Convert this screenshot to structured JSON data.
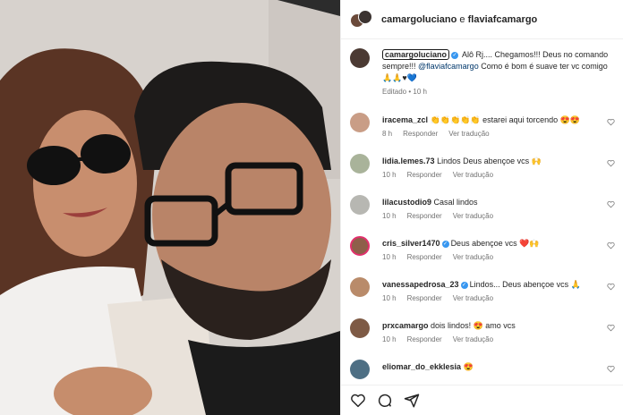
{
  "header": {
    "user1": "camargoluciano",
    "connector": "e",
    "user2": "flaviafcamargo"
  },
  "caption": {
    "username": "camargoluciano",
    "text_part1": "Alô Rj.... Chegamos!!! Deus no comando sempre!!!",
    "mention": "@flaviafcamargo",
    "text_part2": "Como é bom é suave ter vc comigo",
    "emojis": "🙏🙏♥💙",
    "meta": "Editado • 10 h"
  },
  "comments": [
    {
      "username": "iracema_zcl",
      "text": "👏👏👏👏👏 estarei aqui torcendo 😍😍",
      "time": "8 h",
      "reply": "Responder",
      "translate": "Ver tradução",
      "verified": false
    },
    {
      "username": "lidia.lemes.73",
      "text": "Lindos Deus abençoe vcs 🙌",
      "time": "10 h",
      "reply": "Responder",
      "translate": "Ver tradução",
      "verified": false
    },
    {
      "username": "lilacustodio9",
      "text": "Casal lindos",
      "time": "10 h",
      "reply": "Responder",
      "translate": "Ver tradução",
      "verified": false
    },
    {
      "username": "cris_silver1470",
      "text": "Deus abençoe vcs ❤️🙌",
      "time": "10 h",
      "reply": "Responder",
      "translate": "Ver tradução",
      "verified": true
    },
    {
      "username": "vanessapedrosa_23",
      "text": "Lindos... Deus abençoe vcs 🙏",
      "time": "10 h",
      "reply": "Responder",
      "translate": "Ver tradução",
      "verified": true
    },
    {
      "username": "prxcamargo",
      "text": "dois lindos! 😍 amo vcs",
      "time": "10 h",
      "reply": "Responder",
      "translate": "Ver tradução",
      "verified": false
    },
    {
      "username": "eliomar_do_ekklesia",
      "text": "😍",
      "time": "",
      "reply": "",
      "translate": "",
      "verified": false
    }
  ],
  "icons": {
    "like": "heart-icon",
    "comment": "comment-icon",
    "share": "share-icon"
  },
  "colors": {
    "verified": "#3897f0",
    "mention": "#00376b",
    "meta": "#737373"
  }
}
